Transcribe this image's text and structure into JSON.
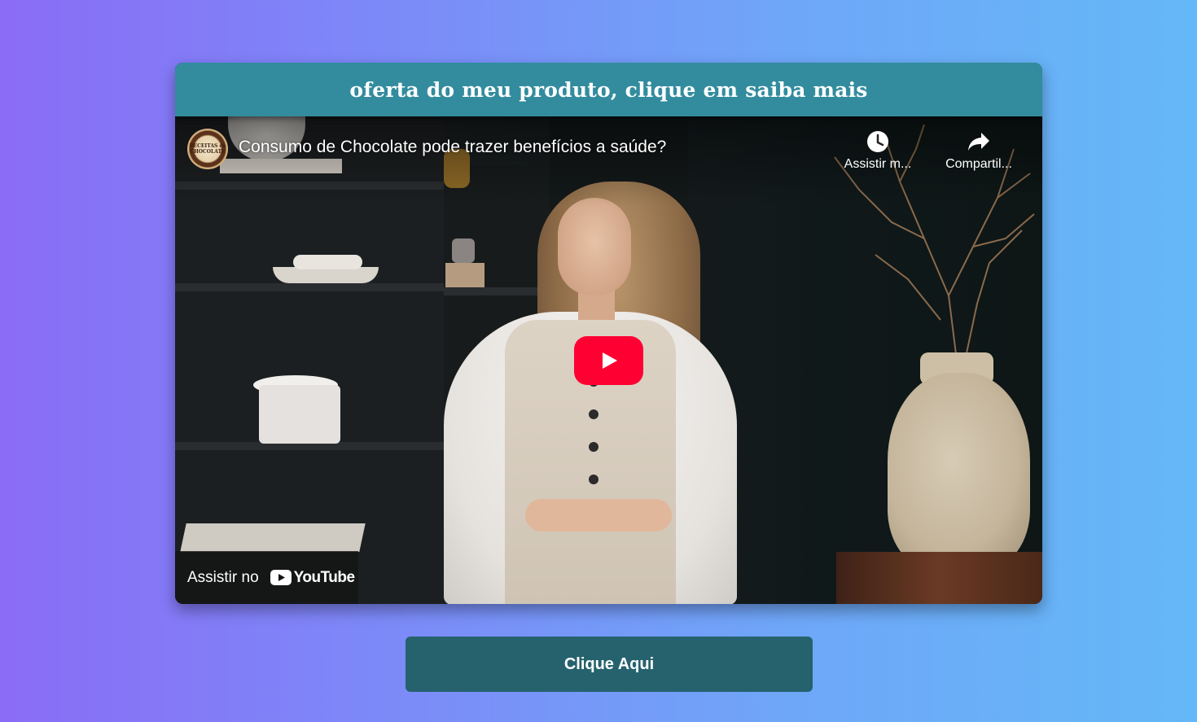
{
  "header": {
    "title": "oferta do meu produto, clique em saiba mais"
  },
  "video": {
    "title": "Consumo de Chocolate pode trazer benefícios a saúde?",
    "channel_logo_text": "RECEITAS de CHOCOLATE",
    "watch_later_label": "Assistir m...",
    "share_label": "Compartil...",
    "watch_on_label": "Assistir no",
    "youtube_word": "YouTube",
    "colors": {
      "play_button": "#ff0033"
    }
  },
  "cta": {
    "label": "Clique Aqui",
    "color": "#25626e"
  },
  "colors": {
    "header_bg": "#328c9e",
    "background_start": "#8a6cf6",
    "background_end": "#64b8f7"
  }
}
